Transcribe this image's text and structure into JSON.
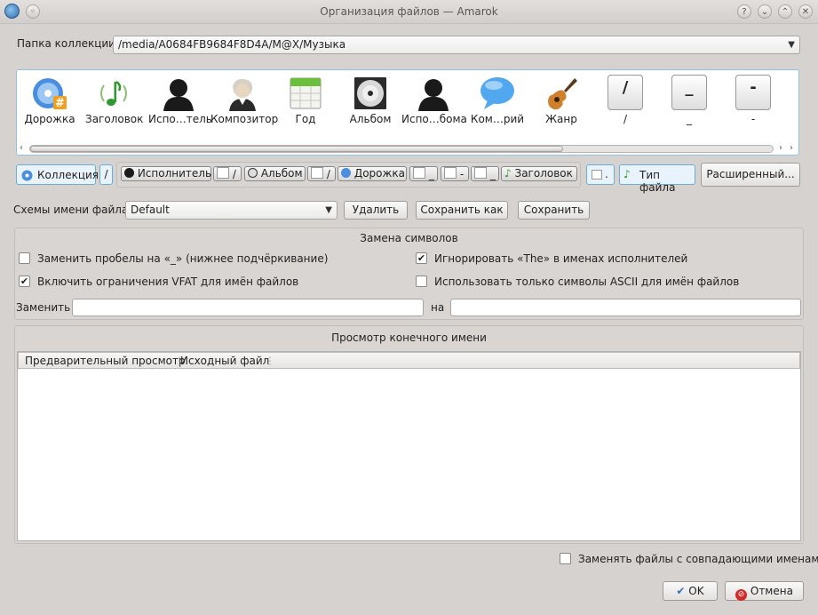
{
  "window": {
    "title": "Организация файлов — Amarok",
    "controls": [
      "?",
      "⌄",
      "⌃",
      "✕"
    ]
  },
  "collection_folder": {
    "label": "Папка коллекции:",
    "value": "/media/A0684FB9684F8D4A/M@X/Музыка"
  },
  "tokens": [
    {
      "name": "Дорожка",
      "icon": "track-disc-icon"
    },
    {
      "name": "Заголовок",
      "icon": "music-note-icon"
    },
    {
      "name": "Испо…тель",
      "icon": "artist-icon"
    },
    {
      "name": "Композитор",
      "icon": "composer-icon"
    },
    {
      "name": "Год",
      "icon": "calendar-icon"
    },
    {
      "name": "Альбом",
      "icon": "album-cd-icon"
    },
    {
      "name": "Испо…бома",
      "icon": "album-artist-icon"
    },
    {
      "name": "Ком…рий",
      "icon": "comment-bubble-icon"
    },
    {
      "name": "Жанр",
      "icon": "guitar-icon"
    },
    {
      "name": "/",
      "key": "/"
    },
    {
      "name": "_",
      "key": "_"
    },
    {
      "name": "-",
      "key": "-"
    }
  ],
  "format_chips": {
    "collection": "Коллекция",
    "sep1": "/",
    "artist": "Исполнитель",
    "slash1": "/",
    "album": "Альбом",
    "slash2": "/",
    "track": "Дорожка",
    "under1": "_",
    "dash": "-",
    "under2": "_",
    "title": "Заголовок",
    "dot": ".",
    "filetype": "Тип файла"
  },
  "advanced_button": "Расширенный...",
  "scheme": {
    "label": "Схемы имени файла:",
    "value": "Default",
    "delete": "Удалить",
    "save_as": "Сохранить как",
    "save": "Сохранить"
  },
  "replace_group": {
    "title": "Замена символов",
    "spaces": {
      "label": "Заменить пробелы на «_» (нижнее подчёркивание)",
      "checked": false
    },
    "ignore_the": {
      "label": "Игнорировать «The» в именах исполнителей",
      "checked": true
    },
    "vfat": {
      "label": "Включить ограничения VFAT для имён файлов",
      "checked": true
    },
    "ascii": {
      "label": "Использовать только символы ASCII для имён файлов",
      "checked": false
    },
    "replace_label": "Заменить",
    "with_label": "на",
    "replace_value": "",
    "with_value": ""
  },
  "preview_group": {
    "title": "Просмотр конечного имени",
    "columns": [
      "Предварительный просмотр",
      "Исходный файл"
    ]
  },
  "overwrite": {
    "label": "Заменять файлы с совпадающими именами",
    "checked": false
  },
  "ok": "OK",
  "cancel": "Отмена",
  "colors": {
    "accent": "#3a8ee0",
    "panel_border": "#8fc3e6"
  }
}
